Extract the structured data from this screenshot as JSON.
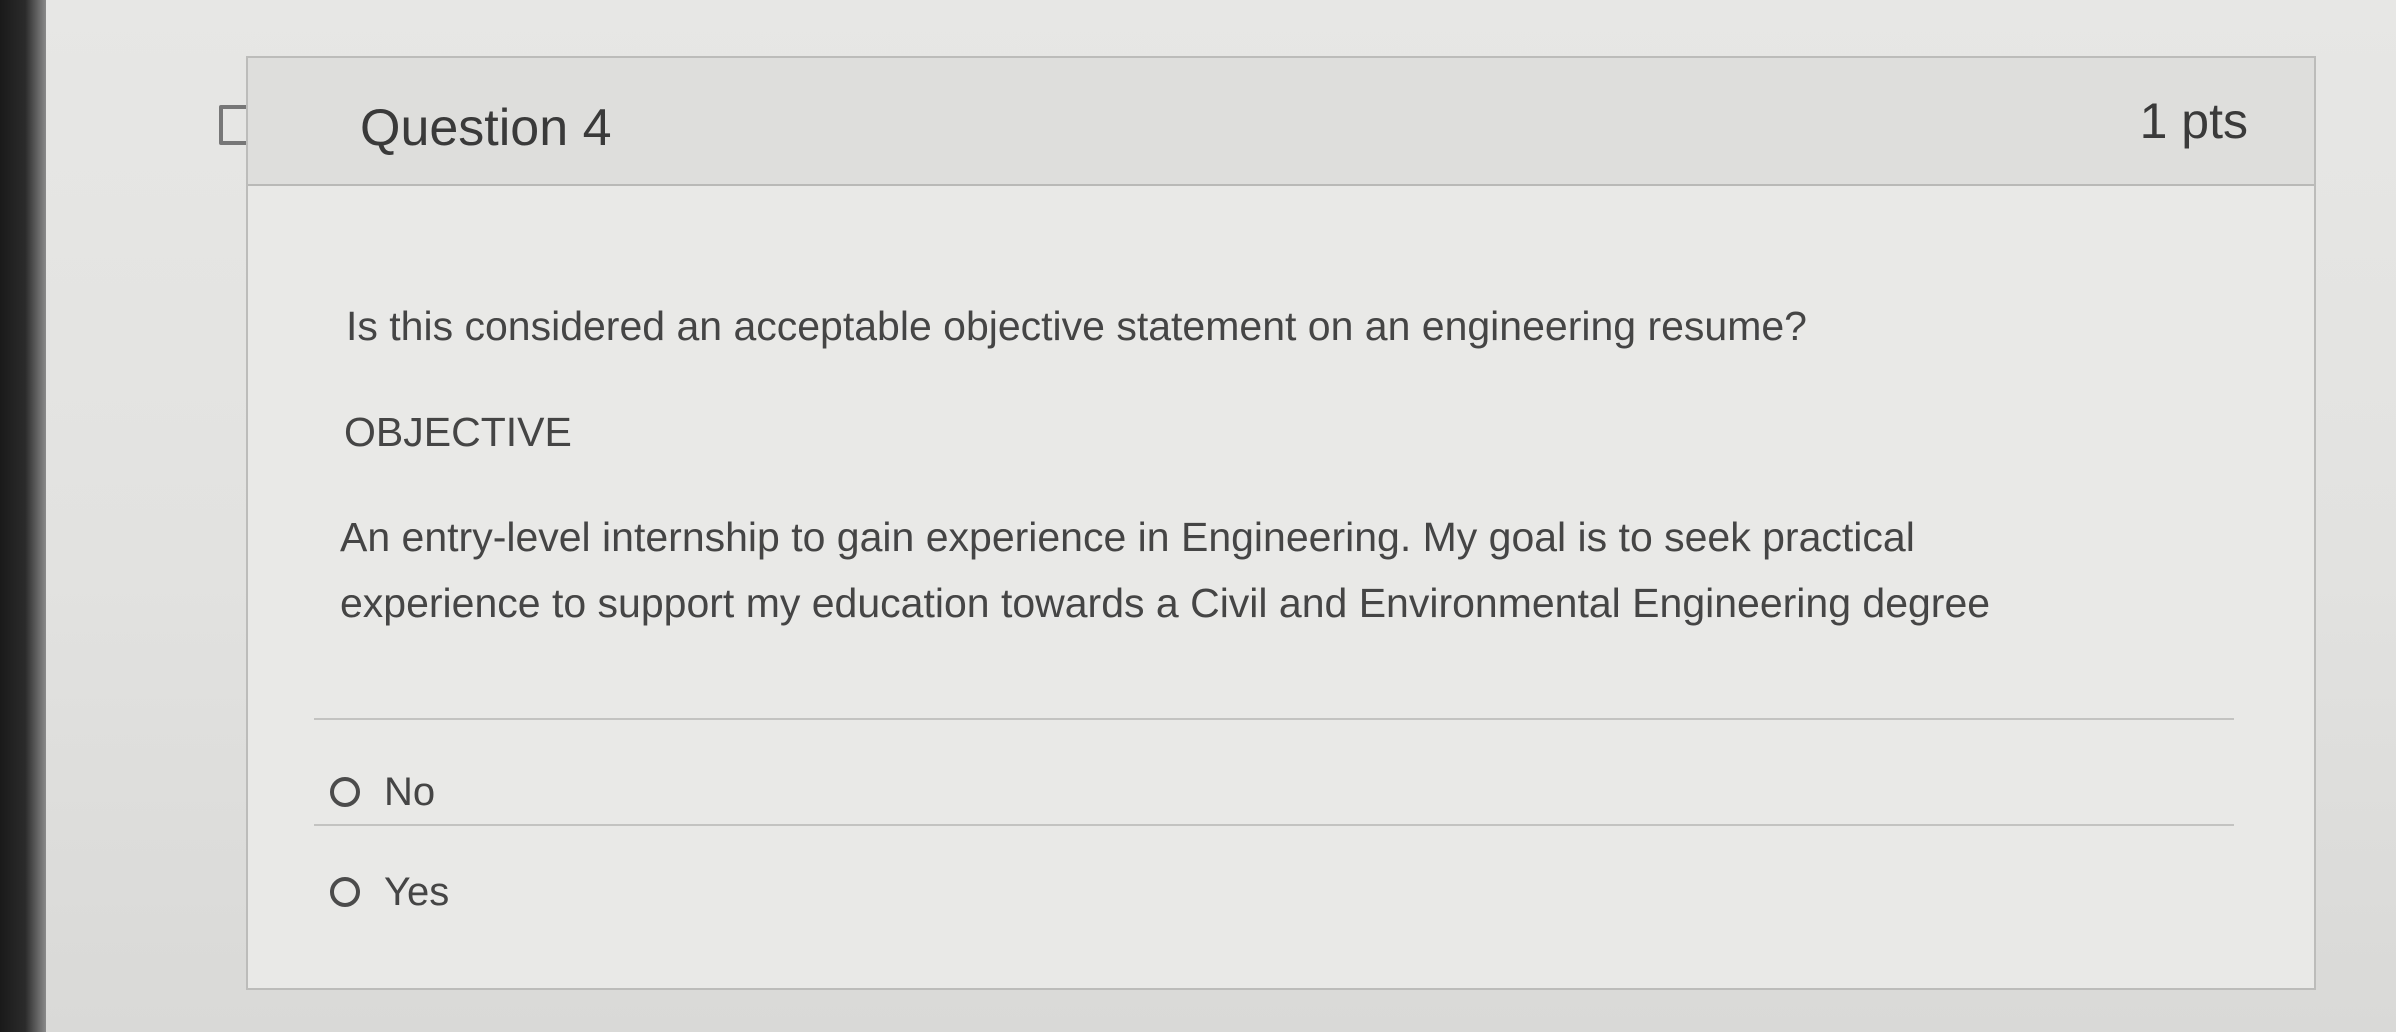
{
  "question": {
    "title": "Question 4",
    "points": "1 pts",
    "text": "Is this considered an acceptable objective statement on an engineering resume?",
    "objective_heading": "OBJECTIVE",
    "objective_lines": [
      "An entry-level internship to gain experience in Engineering. My goal is to seek practical",
      "experience to support my education towards a Civil and Environmental Engineering degree"
    ]
  },
  "answers": [
    {
      "label": "No",
      "selected": false
    },
    {
      "label": "Yes",
      "selected": false
    }
  ],
  "icons": {
    "flag": "flag-outline-icon",
    "radio": "radio-unselected-icon"
  },
  "colors": {
    "text": "#454545",
    "header_background": "#dededc",
    "card_background": "#e9e9e7",
    "border": "#bcbcba"
  }
}
